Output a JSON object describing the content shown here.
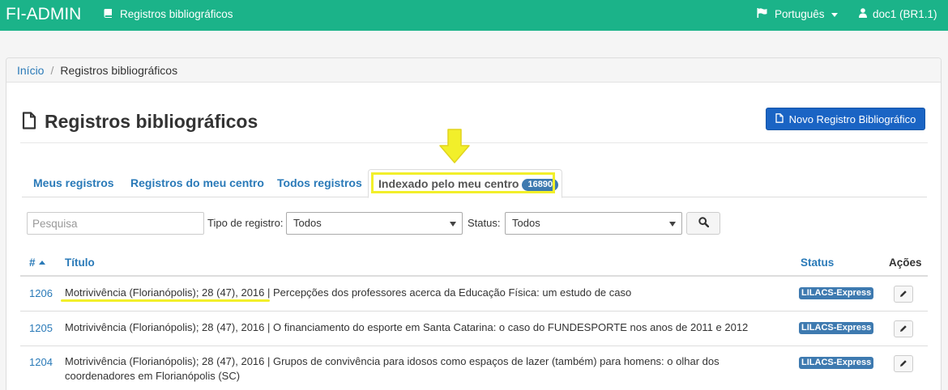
{
  "navbar": {
    "brand": "FI-ADMIN",
    "section_link": "Registros bibliográficos",
    "language": "Português",
    "user": "doc1 (BR1.1)"
  },
  "breadcrumb": {
    "home": "Início",
    "separator": "/",
    "current": "Registros bibliográficos"
  },
  "page": {
    "title": "Registros bibliográficos",
    "new_button": "Novo Registro Bibliográfico"
  },
  "tabs": [
    {
      "label": "Meus registros"
    },
    {
      "label": "Registros do meu centro"
    },
    {
      "label": "Todos registros"
    },
    {
      "label": "Indexado pelo meu centro",
      "badge": "16890",
      "active": true
    }
  ],
  "filters": {
    "search_placeholder": "Pesquisa",
    "type_label": "Tipo de registro:",
    "type_value": "Todos",
    "status_label": "Status:",
    "status_value": "Todos"
  },
  "table": {
    "headers": {
      "id": "#",
      "title": "Título",
      "status": "Status",
      "actions": "Ações"
    },
    "rows": [
      {
        "id": "1206",
        "title": "Motrivivência (Florianópolis); 28 (47), 2016 | Percepções dos professores acerca da Educação Física: um estudo de caso",
        "status": "LILACS-Express"
      },
      {
        "id": "1205",
        "title": "Motrivivência (Florianópolis); 28 (47), 2016 | O financiamento do esporte em Santa Catarina: o caso do FUNDESPORTE nos anos de 2011 e 2012",
        "status": "LILACS-Express"
      },
      {
        "id": "1204",
        "title": "Motrivivência (Florianópolis); 28 (47), 2016 | Grupos de convivência para idosos como espaços de lazer (também) para homens: o olhar dos coordenadores em Florianópolis (SC)",
        "status": "LILACS-Express"
      }
    ]
  },
  "colors": {
    "navbar": "#1bb389",
    "link": "#2a7ab8",
    "primary_button": "#1a64c4",
    "badge": "#3e7ab0",
    "highlight": "#f2ef2a"
  },
  "icons": {
    "navbar_section": "book-icon",
    "language": "flag-icon",
    "user": "user-icon",
    "title": "document-icon",
    "search_button": "magnifier-icon",
    "edit": "pencil-icon",
    "annotation": "arrow-down-icon"
  }
}
